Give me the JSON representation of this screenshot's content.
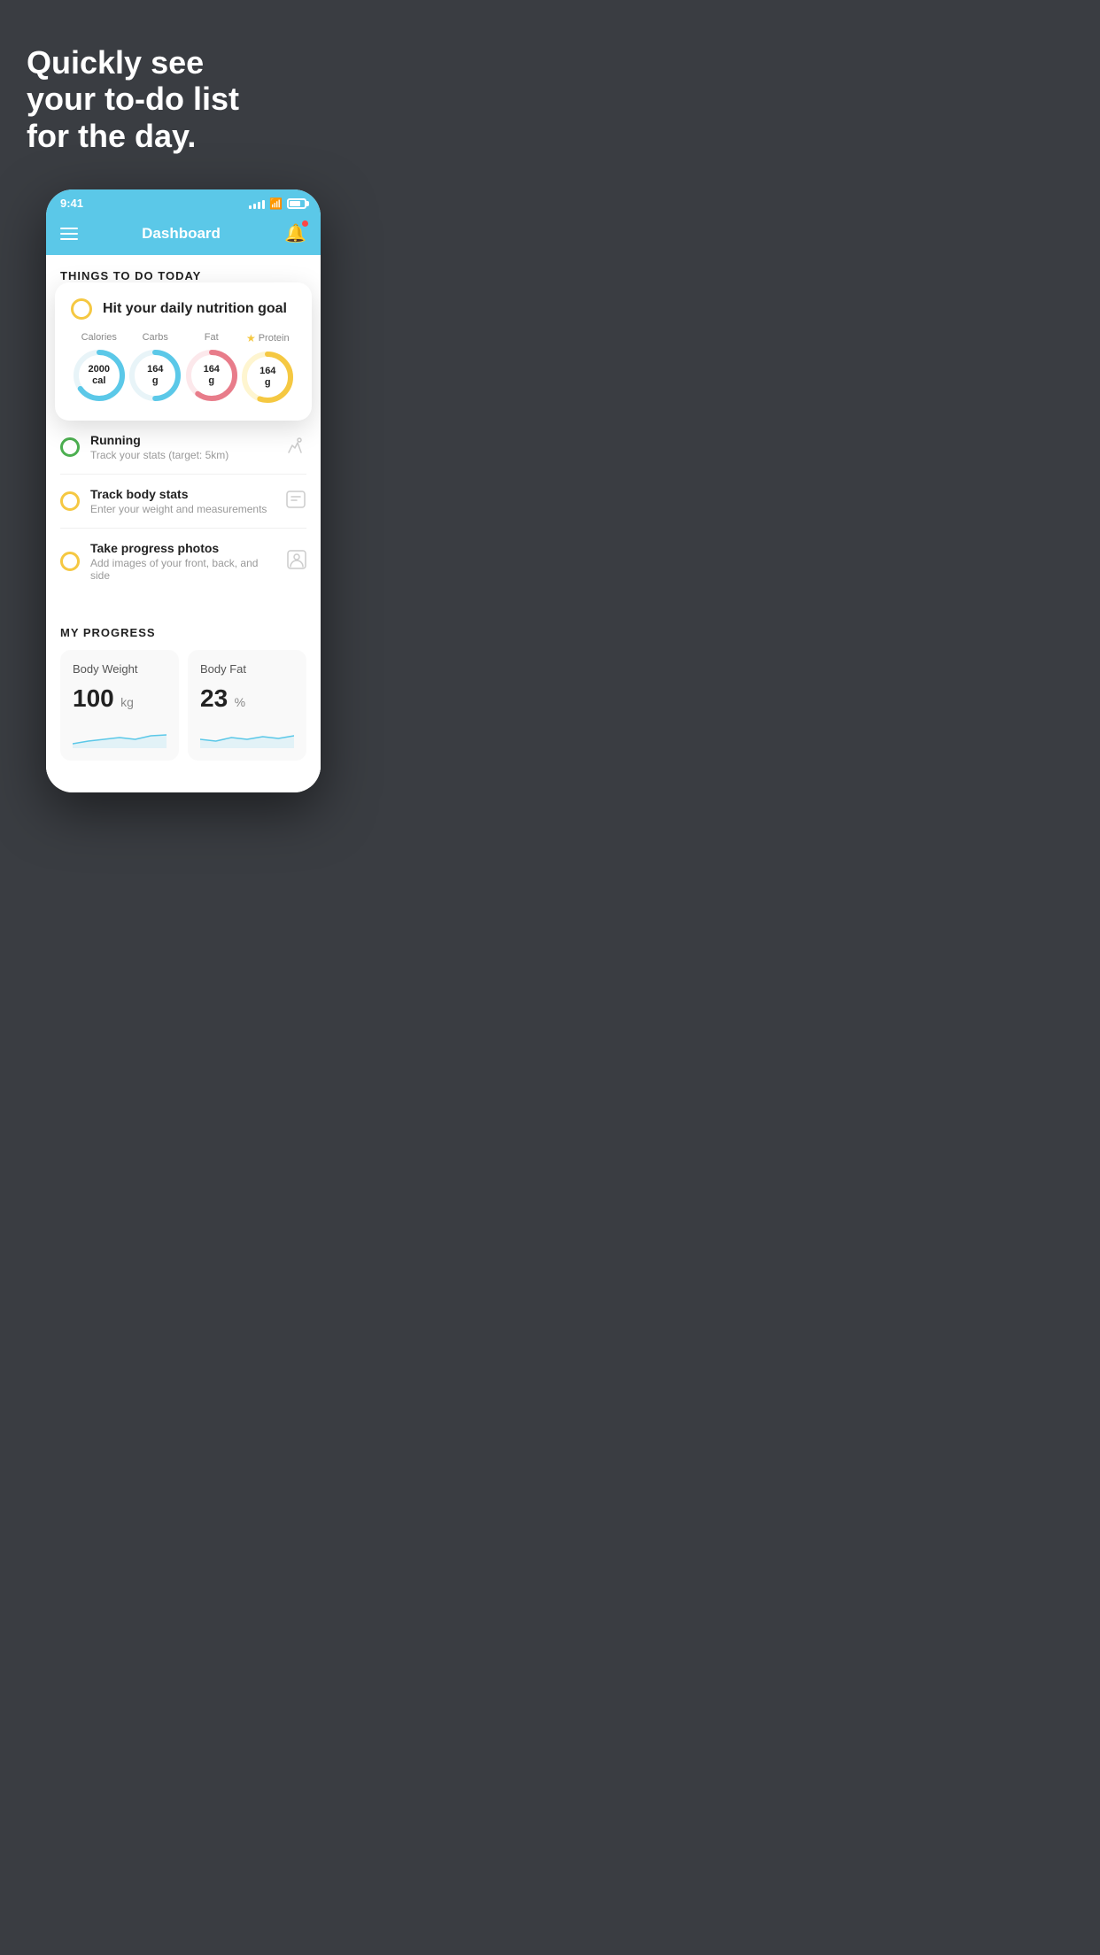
{
  "hero": {
    "title": "Quickly see\nyour to-do list\nfor the day."
  },
  "phone": {
    "status_bar": {
      "time": "9:41"
    },
    "nav": {
      "title": "Dashboard"
    },
    "things_today": {
      "section_title": "THINGS TO DO TODAY",
      "nutrition_card": {
        "title": "Hit your daily nutrition goal",
        "metrics": [
          {
            "label": "Calories",
            "value": "2000",
            "unit": "cal",
            "color": "#5bc8e8",
            "percent": 65,
            "star": false
          },
          {
            "label": "Carbs",
            "value": "164",
            "unit": "g",
            "color": "#5bc8e8",
            "percent": 50,
            "star": false
          },
          {
            "label": "Fat",
            "value": "164",
            "unit": "g",
            "color": "#e87c8a",
            "percent": 60,
            "star": false
          },
          {
            "label": "Protein",
            "value": "164",
            "unit": "g",
            "color": "#f5c842",
            "percent": 55,
            "star": true
          }
        ]
      },
      "todo_items": [
        {
          "title": "Running",
          "subtitle": "Track your stats (target: 5km)",
          "circle_color": "green",
          "icon": "👟"
        },
        {
          "title": "Track body stats",
          "subtitle": "Enter your weight and measurements",
          "circle_color": "yellow",
          "icon": "⚖️"
        },
        {
          "title": "Take progress photos",
          "subtitle": "Add images of your front, back, and side",
          "circle_color": "yellow",
          "icon": "👤"
        }
      ]
    },
    "progress": {
      "section_title": "MY PROGRESS",
      "cards": [
        {
          "title": "Body Weight",
          "value": "100",
          "unit": "kg"
        },
        {
          "title": "Body Fat",
          "value": "23",
          "unit": "%"
        }
      ]
    }
  }
}
